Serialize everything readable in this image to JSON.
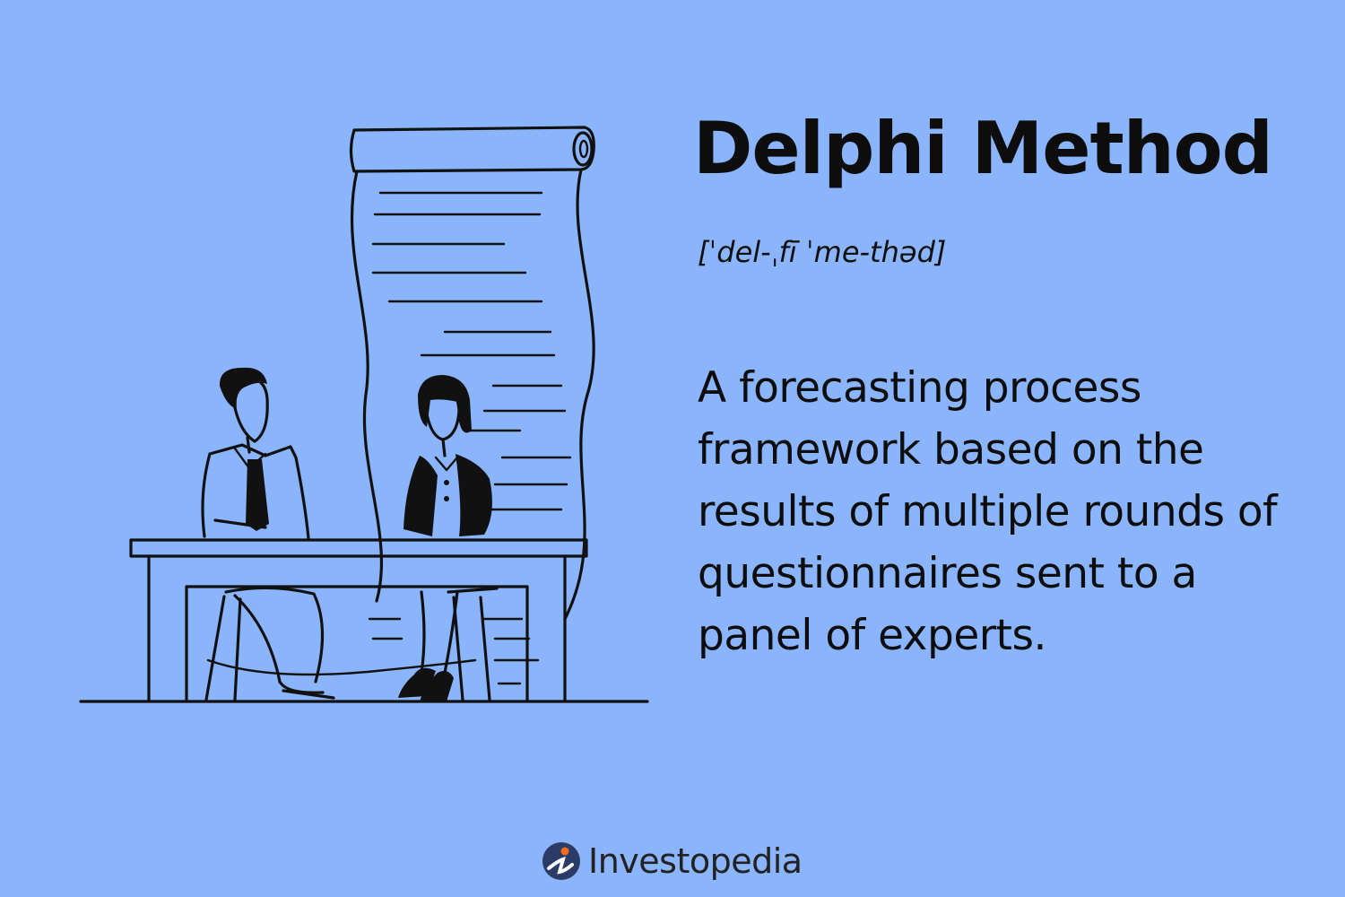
{
  "header": {
    "title": "Delphi Method",
    "pronunciation": "[ˈdel-ˌfī ˈme-thəd]"
  },
  "definition": {
    "text": "A forecasting process framework based on the results of multiple rounds of questionnaires sent to a panel of experts."
  },
  "brand": {
    "name": "Investopedia",
    "logo_icon": "investopedia-logo-icon",
    "logo_color": "#2b3a67",
    "logo_accent": "#f26b21"
  },
  "colors": {
    "background": "#8ab4fb",
    "ink": "#111111"
  }
}
